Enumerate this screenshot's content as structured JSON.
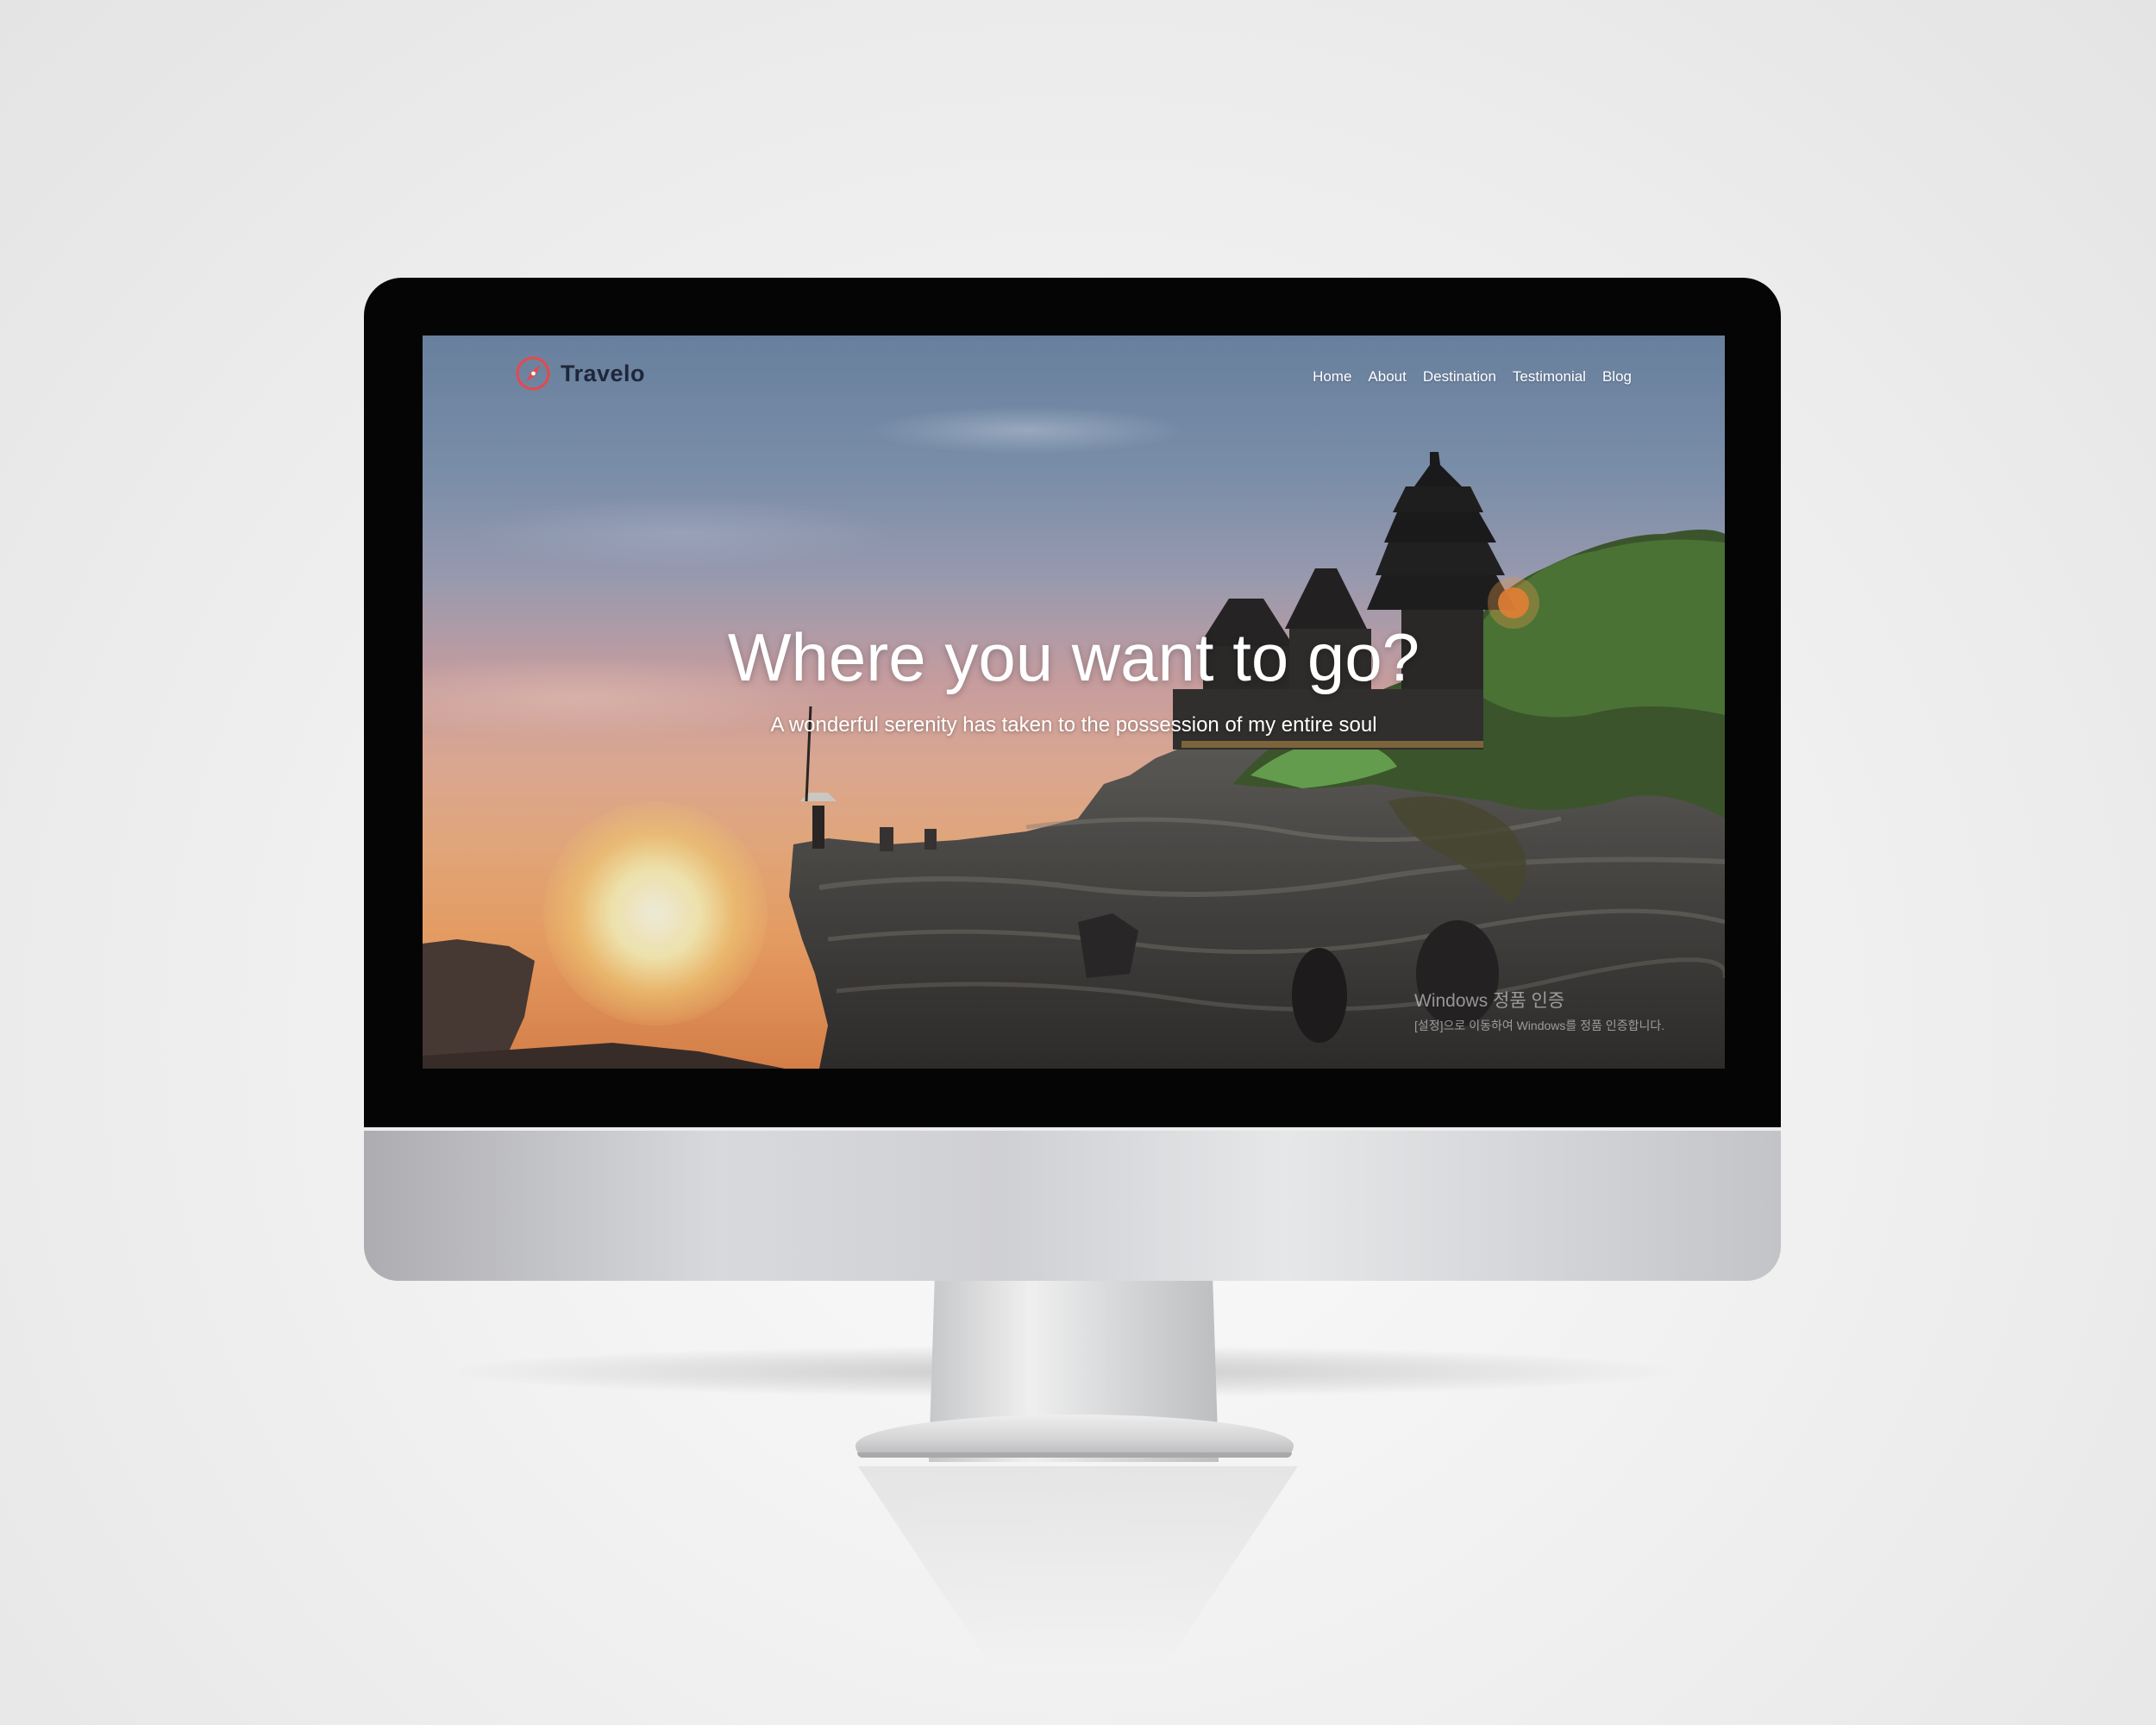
{
  "site": {
    "brand": "Travelo",
    "brand_icon": "compass-logo-icon",
    "brand_color": "#e8474b",
    "nav": [
      {
        "label": "Home"
      },
      {
        "label": "About"
      },
      {
        "label": "Destination"
      },
      {
        "label": "Testimonial"
      },
      {
        "label": "Blog"
      }
    ],
    "hero": {
      "title": "Where you want to go?",
      "subtitle": "A wonderful serenity has taken to the possession of my entire soul"
    },
    "watermark": {
      "title": "Windows 정품 인증",
      "subtitle": "[설정]으로 이동하여 Windows를 정품 인증합니다."
    }
  }
}
